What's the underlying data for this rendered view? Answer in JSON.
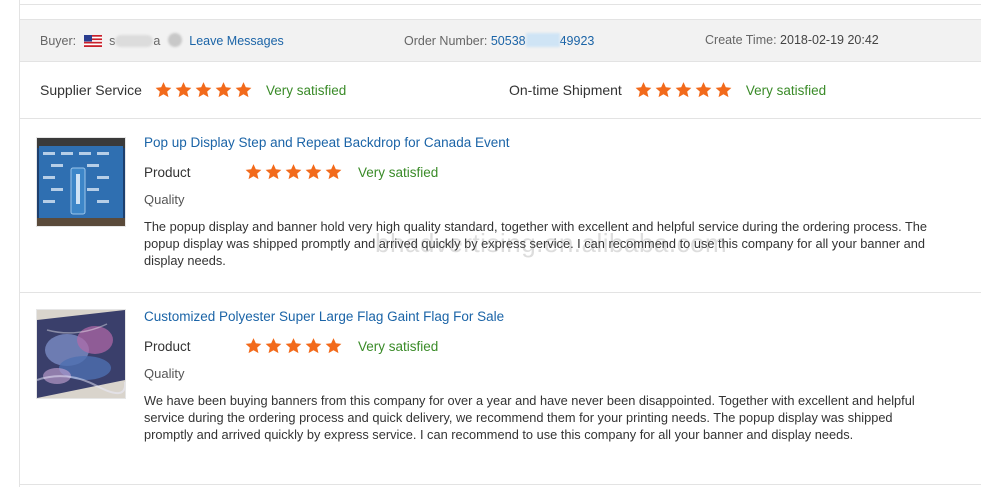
{
  "header": {
    "buyer_label": "Buyer:",
    "buyer_name_start": "s",
    "buyer_name_end": "a",
    "leave_messages": "Leave Messages",
    "order_label": "Order Number:",
    "order_start": "50538",
    "order_end": "49923",
    "create_label": "Create Time:",
    "create_time": "2018-02-19 20:42"
  },
  "ratings": {
    "supplier_label": "Supplier Service",
    "supplier_value": "Very satisfied",
    "supplier_stars": 5,
    "shipment_label": "On-time Shipment",
    "shipment_value": "Very satisfied",
    "shipment_stars": 5
  },
  "reviews": [
    {
      "title": "Pop up Display Step and Repeat Backdrop for Canada Event",
      "product_label": "Product",
      "product_stars": 5,
      "product_value": "Very satisfied",
      "quality_label": "Quality",
      "text": "The popup display and banner hold very high quality standard, together with excellent and helpful service during the ordering process. The popup display was shipped promptly and arrived quickly by express service. I can recommend to use this company for all your banner and display needs."
    },
    {
      "title": "Customized Polyester Super Large Flag Gaint Flag For Sale",
      "product_label": "Product",
      "product_stars": 5,
      "product_value": "Very satisfied",
      "quality_label": "Quality",
      "text": "We have been buying banners from this company for over a year and have never been disappointed. Together with excellent and helpful service during the ordering process and quick delivery, we recommend them for your printing needs. The popup display was shipped promptly and arrived quickly by express service. I can recommend to use this company for all your banner and display needs."
    }
  ],
  "watermark": "bhadvertising.en.alibaba.com",
  "colors": {
    "star": "#f26a1b",
    "satisfied": "#3a8b28",
    "link": "#1b64a7",
    "header_bg": "#f2f2f2"
  },
  "icons": {
    "flag": "us-flag-icon",
    "star": "star-icon"
  }
}
